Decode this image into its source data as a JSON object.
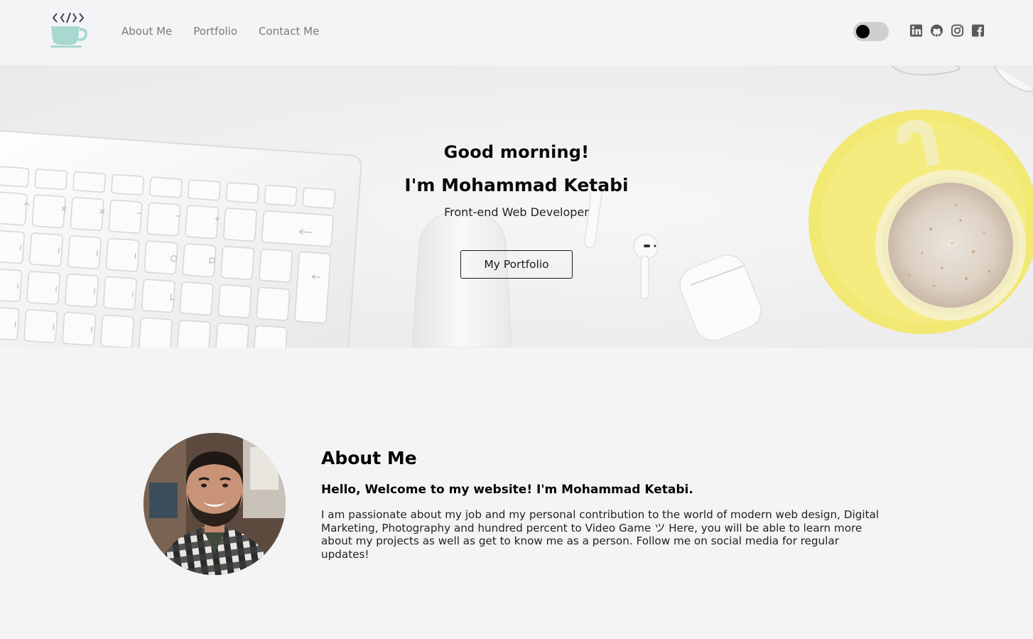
{
  "navbar": {
    "logo_icon": "coffee-code-cup-icon",
    "links": [
      {
        "label": "About Me"
      },
      {
        "label": "Portfolio"
      },
      {
        "label": "Contact Me"
      }
    ],
    "theme_toggle": {
      "state": "off"
    },
    "socials": [
      {
        "icon": "linkedin-icon"
      },
      {
        "icon": "github-icon"
      },
      {
        "icon": "instagram-icon"
      },
      {
        "icon": "facebook-icon"
      }
    ]
  },
  "hero": {
    "greeting": "Good morning!",
    "name": "I'm Mohammad Ketabi",
    "role": "Front-end Web Developer",
    "button_label": "My Portfolio"
  },
  "about": {
    "title": "About Me",
    "subtitle": "Hello, Welcome to my website! I'm Mohammad Ketabi.",
    "body": "I am passionate about my job and my personal contribution to the world of modern web design, Digital Marketing, Photography and hundred percent to Video Game ツ Here, you will be able to learn more about my projects as well as get to know me as a person. Follow me on social media for regular updates!"
  },
  "colors": {
    "page_bg": "#f4f4f6",
    "logo_cup": "#a8d8d0",
    "logo_code": "#3d4254",
    "saucer": "#f2e874",
    "social_icon": "#5a5a5a"
  }
}
